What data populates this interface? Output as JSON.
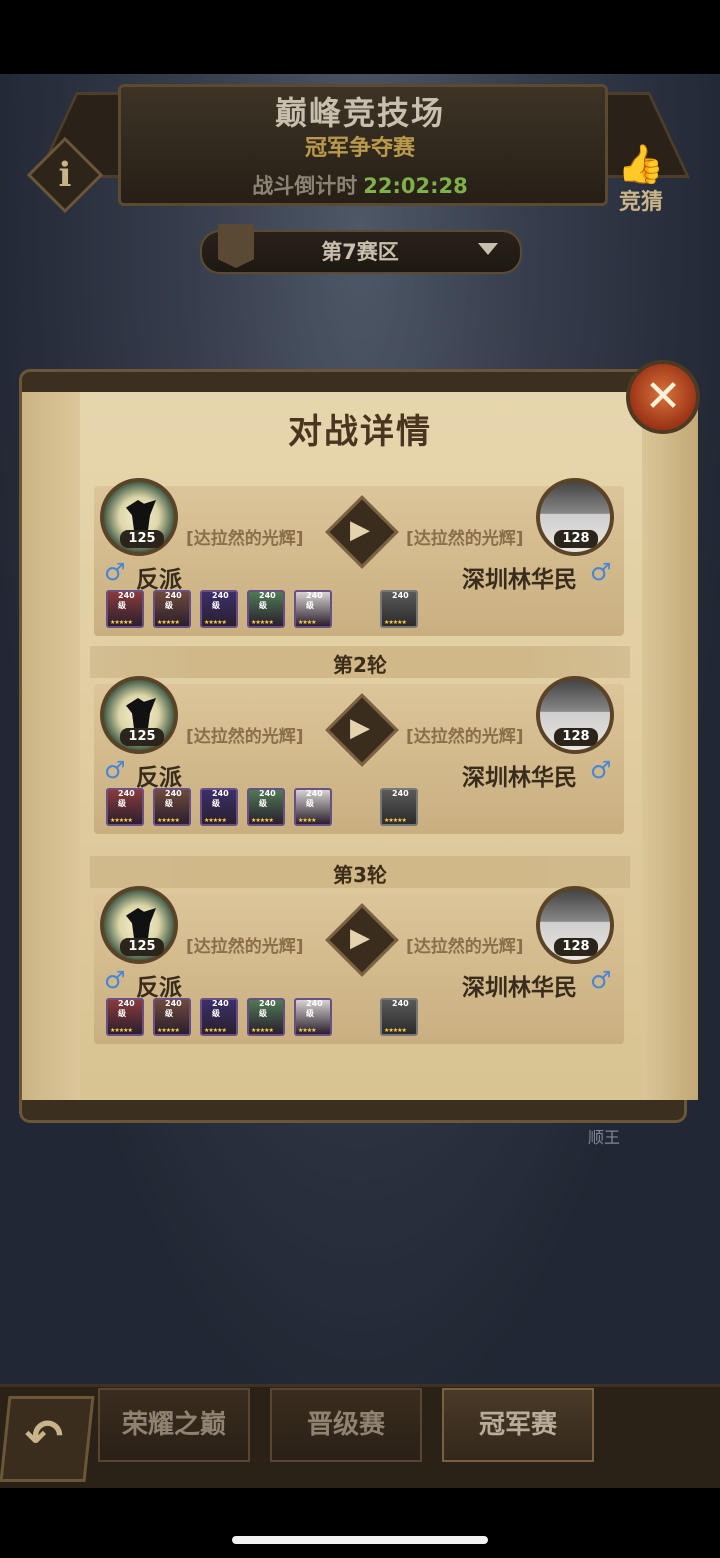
{
  "header": {
    "title": "巅峰竞技场",
    "subtitle": "冠军争夺赛",
    "countdown_label": "战斗倒计时",
    "countdown_time": "22:02:28",
    "guess_label": "竞猜"
  },
  "region": {
    "label": "第7赛区"
  },
  "modal": {
    "title": "对战详情",
    "close_icon": "close-icon"
  },
  "matches": [
    {
      "left": {
        "level": "125",
        "guild": "[达拉然的光辉]",
        "name": "反派",
        "gender": "♂",
        "heroes": [
          {
            "lvl": "240级",
            "stars": "★★★★★"
          },
          {
            "lvl": "240级",
            "stars": "★★★★★"
          },
          {
            "lvl": "240级",
            "stars": "★★★★★"
          },
          {
            "lvl": "240级",
            "stars": "★★★★★"
          },
          {
            "lvl": "240级",
            "stars": "★★★★"
          }
        ]
      },
      "right": {
        "level": "128",
        "guild": "[达拉然的光辉]",
        "name": "深圳林华民",
        "gender": "♂",
        "heroes": [
          {
            "lvl": "240",
            "stars": "★★★★★"
          }
        ]
      }
    },
    {
      "round_label": "第2轮",
      "left": {
        "level": "125",
        "guild": "[达拉然的光辉]",
        "name": "反派",
        "gender": "♂",
        "heroes": [
          {
            "lvl": "240级",
            "stars": "★★★★★"
          },
          {
            "lvl": "240级",
            "stars": "★★★★★"
          },
          {
            "lvl": "240级",
            "stars": "★★★★★"
          },
          {
            "lvl": "240级",
            "stars": "★★★★★"
          },
          {
            "lvl": "240级",
            "stars": "★★★★"
          }
        ]
      },
      "right": {
        "level": "128",
        "guild": "[达拉然的光辉]",
        "name": "深圳林华民",
        "gender": "♂",
        "heroes": [
          {
            "lvl": "240",
            "stars": "★★★★★"
          }
        ]
      }
    },
    {
      "round_label": "第3轮",
      "left": {
        "level": "125",
        "guild": "[达拉然的光辉]",
        "name": "反派",
        "gender": "♂",
        "heroes": [
          {
            "lvl": "240级",
            "stars": "★★★★★"
          },
          {
            "lvl": "240级",
            "stars": "★★★★★"
          },
          {
            "lvl": "240级",
            "stars": "★★★★★"
          },
          {
            "lvl": "240级",
            "stars": "★★★★★"
          },
          {
            "lvl": "240级",
            "stars": "★★★★"
          }
        ]
      },
      "right": {
        "level": "128",
        "guild": "[达拉然的光辉]",
        "name": "深圳林华民",
        "gender": "♂",
        "heroes": [
          {
            "lvl": "240",
            "stars": "★★★★★"
          }
        ]
      }
    }
  ],
  "watermark": "顺王",
  "bottom_nav": {
    "back_icon": "back-arrow-icon",
    "tabs": [
      {
        "label": "荣耀之巅"
      },
      {
        "label": "晋级赛"
      },
      {
        "label": "冠军赛"
      }
    ]
  },
  "colors": {
    "countdown_time": "#7fb04a",
    "gender_male": "#4a86d6",
    "close_button": "#c4552a",
    "parchment": "#e2cfa3"
  }
}
